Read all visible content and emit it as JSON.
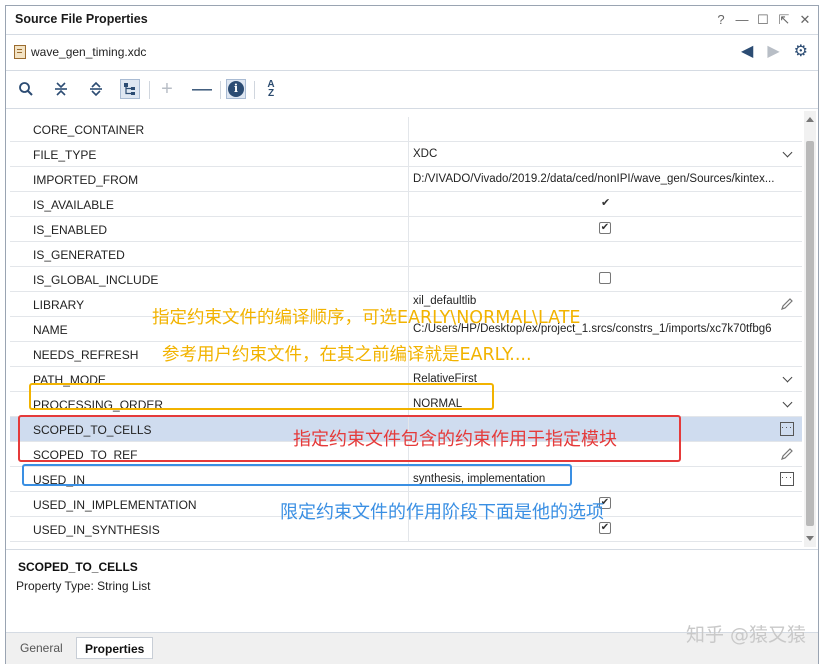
{
  "panel": {
    "title": "Source File Properties",
    "window_buttons": [
      "?",
      "—",
      "☐",
      "⇱",
      "✕"
    ]
  },
  "file": {
    "name": "wave_gen_timing.xdc",
    "nav": {
      "back": "◀",
      "forward": "▶",
      "settings": "⚙"
    }
  },
  "toolbar": {
    "add_glyph": "+",
    "remove_glyph": "—",
    "info_glyph": "i",
    "sort_glyph_a": "A",
    "sort_glyph_z": "Z"
  },
  "properties": [
    {
      "name": "CORE_CONTAINER",
      "value": ""
    },
    {
      "name": "FILE_TYPE",
      "value": "XDC"
    },
    {
      "name": "IMPORTED_FROM",
      "value": "D:/VIVADO/Vivado/2019.2/data/ced/nonIPI/wave_gen/Sources/kintex..."
    },
    {
      "name": "IS_AVAILABLE",
      "value": "",
      "glyph": "✔"
    },
    {
      "name": "IS_ENABLED",
      "value": "",
      "glyph": "✔"
    },
    {
      "name": "IS_GENERATED",
      "value": ""
    },
    {
      "name": "IS_GLOBAL_INCLUDE",
      "value": ""
    },
    {
      "name": "LIBRARY",
      "value": "xil_defaultlib"
    },
    {
      "name": "NAME",
      "value": "C:/Users/HP/Desktop/ex/project_1.srcs/constrs_1/imports/xc7k70tfbg6"
    },
    {
      "name": "NEEDS_REFRESH",
      "value": ""
    },
    {
      "name": "PATH_MODE",
      "value": "RelativeFirst"
    },
    {
      "name": "PROCESSING_ORDER",
      "value": "NORMAL"
    },
    {
      "name": "SCOPED_TO_CELLS",
      "value": "",
      "button_glyph": "···"
    },
    {
      "name": "SCOPED_TO_REF",
      "value": ""
    },
    {
      "name": "USED_IN",
      "value": "synthesis, implementation",
      "button_glyph": "···"
    },
    {
      "name": "USED_IN_IMPLEMENTATION",
      "value": "",
      "glyph": "✔"
    },
    {
      "name": "USED_IN_SYNTHESIS",
      "value": "",
      "glyph": "✔"
    }
  ],
  "details": {
    "name": "SCOPED_TO_CELLS",
    "type": "Property Type: String List"
  },
  "tabs": [
    "General",
    "Properties"
  ],
  "annotations": {
    "processing_order_1": "指定约束文件的编译顺序，可选EARLY\\NORMAL\\LATE",
    "processing_order_2": "参考用户约束文件，在其之前编译就是EARLY....",
    "scoped": "指定约束文件包含的约束作用于指定模块",
    "used_in": "限定约束文件的作用阶段下面是他的选项"
  },
  "colors": {
    "selected_row": "#cfdcef",
    "annotation_yellow": "#f2b300",
    "annotation_red": "#e53a3a",
    "annotation_blue": "#3a8fe3"
  },
  "watermark": "知乎 @猿又猿"
}
